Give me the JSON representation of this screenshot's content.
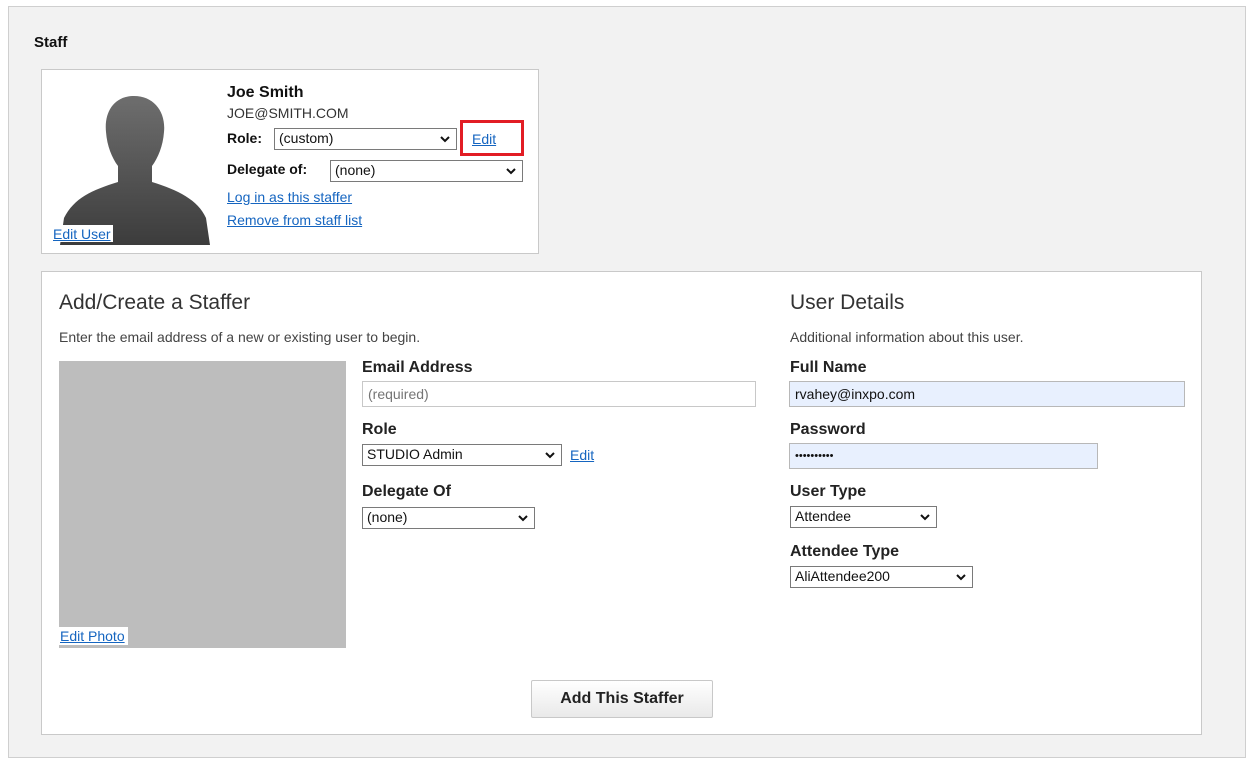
{
  "section": {
    "title": "Staff"
  },
  "staff_card": {
    "name": "Joe Smith",
    "email": "JOE@SMITH.COM",
    "role_label": "Role:",
    "role_value": "(custom)",
    "role_edit": "Edit",
    "delegate_label": "Delegate of:",
    "delegate_value": "(none)",
    "login_link": "Log in as this staffer",
    "remove_link": "Remove from staff list",
    "edit_user": "Edit User"
  },
  "add_staffer": {
    "title": "Add/Create a Staffer",
    "subtitle": "Enter the email address of a new or existing user to begin.",
    "edit_photo": "Edit Photo",
    "email_label": "Email Address",
    "email_placeholder": "(required)",
    "role_label": "Role",
    "role_value": "STUDIO Admin",
    "role_edit": "Edit",
    "delegate_label": "Delegate Of",
    "delegate_value": "(none)",
    "submit": "Add This Staffer"
  },
  "user_details": {
    "title": "User Details",
    "subtitle": "Additional information about this user.",
    "fullname_label": "Full Name",
    "fullname_value": "rvahey@inxpo.com",
    "password_label": "Password",
    "password_value": "••••••••••",
    "usertype_label": "User Type",
    "usertype_value": "Attendee",
    "attendeetype_label": "Attendee Type",
    "attendeetype_value": "AliAttendee200"
  },
  "colors": {
    "link": "#1565c0",
    "highlight": "#e21d24",
    "autofill": "#e8f0fe"
  }
}
